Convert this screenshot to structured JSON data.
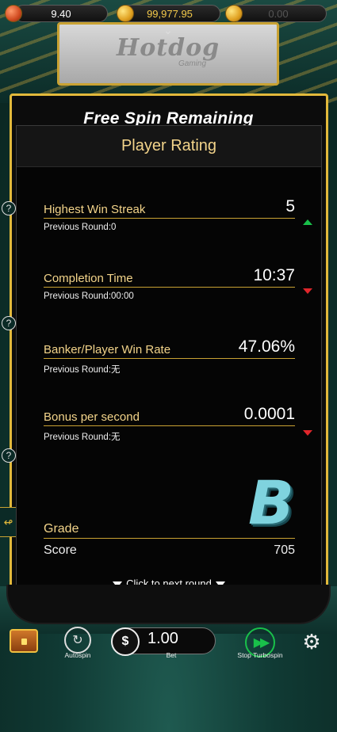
{
  "topbar": {
    "value1": "9.40",
    "balance": "99,977.95",
    "value3": "0.00"
  },
  "logo": {
    "name": "Hotdog",
    "sub": "Gaming"
  },
  "free_spin": {
    "title": "Free Spin Remaining"
  },
  "side": {
    "help_glyph": "?"
  },
  "rating": {
    "title": "Player Rating",
    "stats": [
      {
        "label": "Highest Win Streak",
        "value": "5",
        "trend": "up",
        "previous": "Previous Round:0"
      },
      {
        "label": "Completion Time",
        "value": "10:37",
        "trend": "down",
        "previous": "Previous Round:00:00"
      },
      {
        "label": "Banker/Player Win Rate",
        "value": "47.06%",
        "trend": "none",
        "previous": "Previous Round:无"
      },
      {
        "label": "Bonus per second",
        "value": "0.0001",
        "trend": "down",
        "previous": "Previous Round:无"
      }
    ],
    "grade_label": "Grade",
    "grade": "B",
    "score_label": "Score",
    "score": "705",
    "next_label": "Click to next round"
  },
  "controls": {
    "autospin_label": "Autospin",
    "bet_label": "Bet",
    "bet_value": "1.00",
    "turbo_label": "Stop Turbospin"
  },
  "colors": {
    "gold": "#c9a233",
    "label_gold": "#f3d48a",
    "trend_up": "#19c04a",
    "trend_down": "#e0262b",
    "grade": "#7fd3de"
  }
}
